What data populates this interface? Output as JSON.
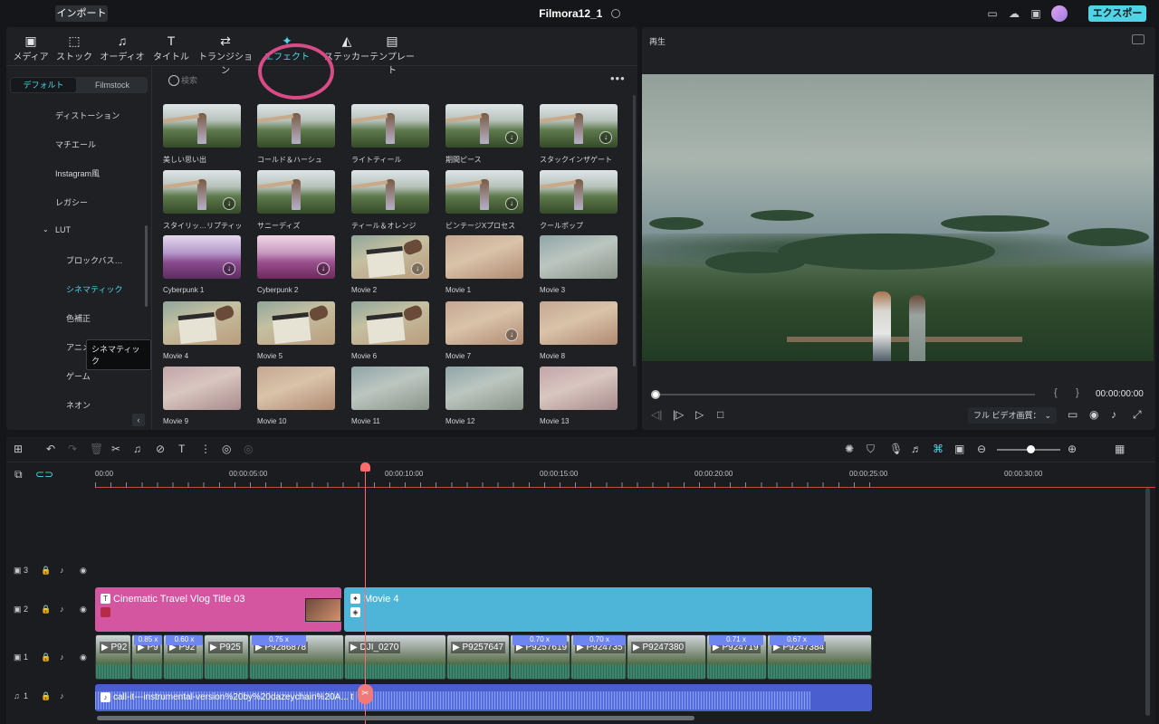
{
  "titlebar": {
    "import_label": "インポート",
    "app_title": "Filmora12_1",
    "export_label": "エクスポート"
  },
  "toolbar_tabs": [
    {
      "label": "メディア",
      "icon": "media-icon"
    },
    {
      "label": "ストック",
      "icon": "stock-icon"
    },
    {
      "label": "オーディオ",
      "icon": "music-note-icon"
    },
    {
      "label": "タイトル",
      "icon": "title-icon"
    },
    {
      "label": "トランジション",
      "icon": "transition-icon"
    },
    {
      "label": "エフェクト",
      "icon": "sparkle-icon"
    },
    {
      "label": "ステッカー",
      "icon": "sticker-icon"
    },
    {
      "label": "テンプレート",
      "icon": "template-icon"
    }
  ],
  "active_tab": "エフェクト",
  "segment": {
    "default": "デフォルト",
    "filmstock": "Filmstock"
  },
  "categories": [
    {
      "label": "ディストーション"
    },
    {
      "label": "マチエール"
    },
    {
      "label": "Instagram風"
    },
    {
      "label": "レガシー"
    },
    {
      "label": "LUT"
    },
    {
      "label": "ブロックバス…"
    },
    {
      "label": "シネマティック"
    },
    {
      "label": "色補正"
    },
    {
      "label": "アニメ"
    },
    {
      "label": "ゲーム"
    },
    {
      "label": "ネオン"
    }
  ],
  "tooltip": "シネマティック",
  "search": {
    "placeholder": "検索"
  },
  "effects": [
    {
      "label": "美しい思い出",
      "style": "photo",
      "download": false
    },
    {
      "label": "コールド＆ハーシュ",
      "style": "photo",
      "download": false
    },
    {
      "label": "ライトティール",
      "style": "photo",
      "download": false
    },
    {
      "label": "期間ピース",
      "style": "photo",
      "download": true
    },
    {
      "label": "スタックインザゲート",
      "style": "photo",
      "download": true
    },
    {
      "label": "スタイリッ…リプティック",
      "style": "photo",
      "download": true
    },
    {
      "label": "サニーディズ",
      "style": "photo",
      "download": false
    },
    {
      "label": "ティール＆オレンジ",
      "style": "photo",
      "download": false
    },
    {
      "label": "ビンテージXプロセス",
      "style": "photo",
      "download": true
    },
    {
      "label": "クールポップ",
      "style": "photo",
      "download": false
    },
    {
      "label": "Cyberpunk 1",
      "style": "cyber",
      "download": true
    },
    {
      "label": "Cyberpunk 2",
      "style": "cyber2",
      "download": true
    },
    {
      "label": "Movie 2",
      "style": "clap",
      "download": true
    },
    {
      "label": "Movie 1",
      "style": "warm",
      "download": false
    },
    {
      "label": "Movie 3",
      "style": "cool",
      "download": false
    },
    {
      "label": "Movie 4",
      "style": "clap",
      "download": false
    },
    {
      "label": "Movie 5",
      "style": "clap",
      "download": false
    },
    {
      "label": "Movie 6",
      "style": "clap",
      "download": false
    },
    {
      "label": "Movie 7",
      "style": "warm",
      "download": true
    },
    {
      "label": "Movie 8",
      "style": "warm",
      "download": false
    },
    {
      "label": "Movie 9",
      "style": "pinkish",
      "download": false
    },
    {
      "label": "Movie 10",
      "style": "warm",
      "download": false
    },
    {
      "label": "Movie 11",
      "style": "cool",
      "download": false
    },
    {
      "label": "Movie 12",
      "style": "cool",
      "download": false
    },
    {
      "label": "Movie 13",
      "style": "pinkish",
      "download": false
    }
  ],
  "player": {
    "label": "再生",
    "timecode": "00:00:00:00",
    "quality": "フル ビデオ画質：",
    "brace_left": "{",
    "brace_right": "}"
  },
  "ruler": [
    "00:00",
    "00:00:05:00",
    "00:00:10:00",
    "00:00:15:00",
    "00:00:20:00",
    "00:00:25:00",
    "00:00:30:00"
  ],
  "tracks": [
    {
      "label": "3"
    },
    {
      "label": "2"
    },
    {
      "label": "1"
    },
    {
      "label": "1"
    }
  ],
  "title_clip": {
    "label": "Cinematic Travel Vlog Title 03"
  },
  "effect_clip": {
    "label": "Movie 4"
  },
  "video_clips": [
    {
      "name": "P92",
      "speed": ""
    },
    {
      "name": "P9",
      "speed": "0.85 x"
    },
    {
      "name": "P92",
      "speed": "0.60 x"
    },
    {
      "name": "P925",
      "speed": ""
    },
    {
      "name": "P9286878",
      "speed": "0.75 x"
    },
    {
      "name": "DJI_0270",
      "speed": ""
    },
    {
      "name": "P9257647",
      "speed": ""
    },
    {
      "name": "P9257619",
      "speed": "0.70 x"
    },
    {
      "name": "P924735",
      "speed": "0.70 x"
    },
    {
      "name": "P9247380",
      "speed": ""
    },
    {
      "name": "P924719",
      "speed": "0.71 x"
    },
    {
      "name": "P9247384",
      "speed": "0.67 x"
    }
  ],
  "audio_clip": {
    "label": "call-it---instrumental-version%20by%20dazeychain%20A... t"
  },
  "colors": {
    "accent": "#4fd3e6",
    "highlight_ring": "#d94a86",
    "title_clip": "#d456a0",
    "effect_clip": "#4fb5d8",
    "audio_clip": "#4b5ed0",
    "playhead": "#ff6b6b"
  }
}
